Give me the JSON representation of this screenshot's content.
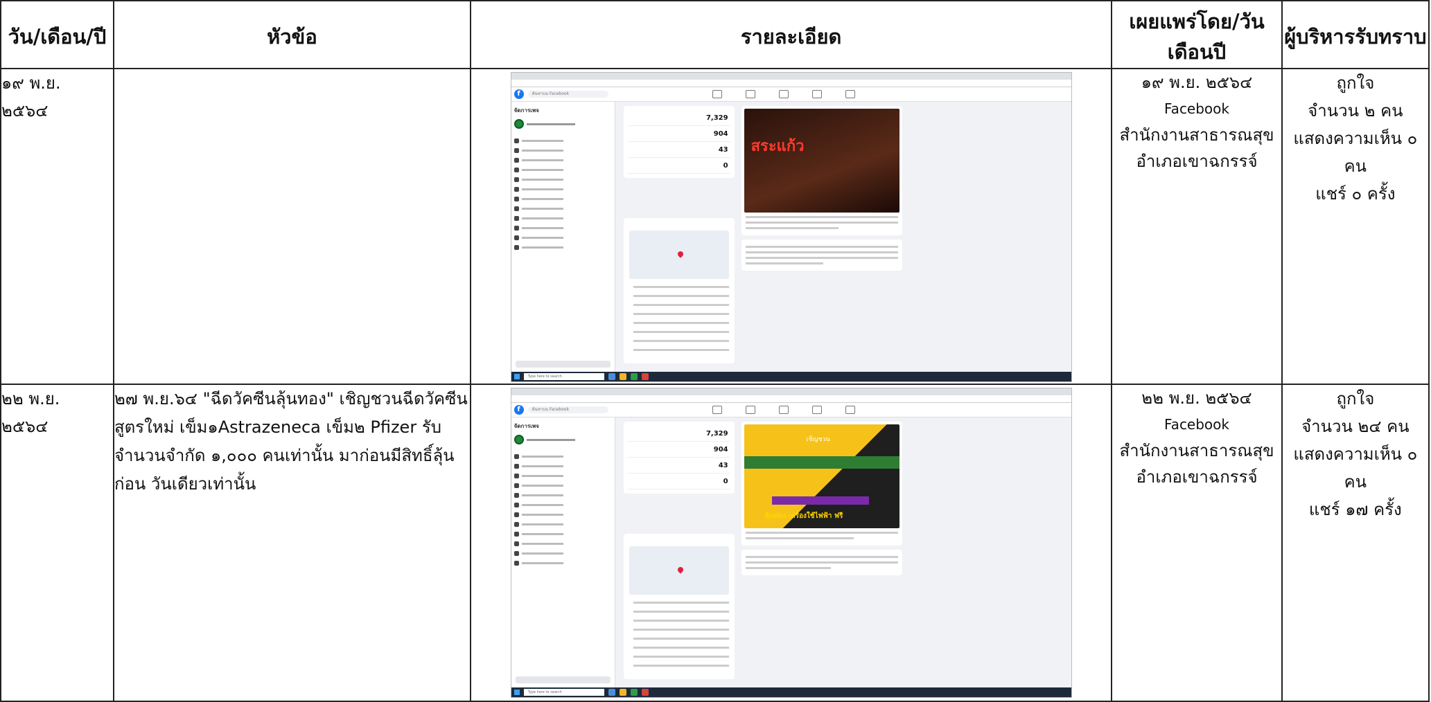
{
  "header": {
    "date": "วัน/เดือน/ปี",
    "topic": "หัวข้อ",
    "detail": "รายละเอียด",
    "published": "เผยแพร่โดย/วันเดือนปี",
    "ack": "ผู้บริหารรับทราบ"
  },
  "rows": [
    {
      "date_line1": "๑๙ พ.ย.",
      "date_line2": "๒๕๖๔",
      "topic": "",
      "pub_date": "๑๙ พ.ย. ๒๕๖๔",
      "pub_channel": "Facebook",
      "pub_org": "สำนักงานสาธารณสุขอำเภอเขาฉกรรจ์",
      "ack_line1": "ถูกใจ",
      "ack_line2": "จำนวน ๒ คน",
      "ack_line3": "แสดงความเห็น ๐ คน",
      "ack_line4": "แชร์ ๐ ครั้ง",
      "shot": {
        "search": "ค้นหาบน Facebook",
        "side_title": "จัดการเพจ",
        "stat1": "7,329",
        "stat2": "904",
        "stat3": "43",
        "stat4": "0",
        "poster_word": "สระแก้ว",
        "taskbar_search": "Type here to search"
      }
    },
    {
      "date_line1": "๒๒ พ.ย.",
      "date_line2": "๒๕๖๔",
      "topic": "๒๗ พ.ย.๖๔ \"ฉีดวัคซีนลุ้นทอง\" เชิญชวนฉีดวัคซีนสูตรใหม่ เข็ม๑Astrazeneca เข็ม๒ Pfizer รับจำนวนจำกัด ๑,๐๐๐ คนเท่านั้น มาก่อนมีสิทธิ์ลุ้นก่อน วันเดียวเท่านั้น",
      "pub_date": "๒๒ พ.ย. ๒๕๖๔",
      "pub_channel": "Facebook",
      "pub_org": "สำนักงานสาธารณสุขอำเภอเขาฉกรรจ์",
      "ack_line1": "ถูกใจ",
      "ack_line2": "จำนวน ๒๔ คน",
      "ack_line3": "แสดงความเห็น ๐ คน",
      "ack_line4": "แชร์ ๑๗ ครั้ง",
      "shot": {
        "search": "ค้นหาบน Facebook",
        "side_title": "จัดการเพจ",
        "stat1": "7,329",
        "stat2": "904",
        "stat3": "43",
        "stat4": "0",
        "poster_word": "เชิญชวน",
        "poster_bottom": "ลุ้นทอง เครื่องใช้ไฟฟ้า ฟรี",
        "taskbar_search": "Type here to search"
      }
    }
  ]
}
